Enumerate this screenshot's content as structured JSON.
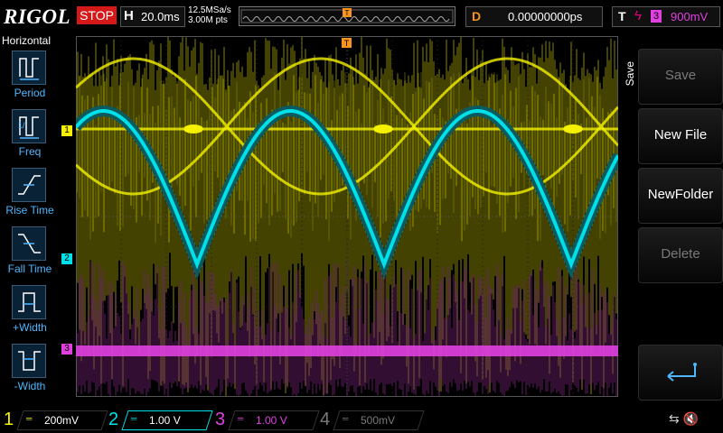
{
  "header": {
    "brand": "RIGOL",
    "run_state": "STOP",
    "timebase_label": "H",
    "timebase_value": "20.0ms",
    "sample_rate": "12.5MSa/s",
    "memory_depth": "3.00M pts",
    "trigger_pos_marker": "T",
    "delay_label": "D",
    "delay_value": "0.00000000ps",
    "trigger_label": "T",
    "trigger_edge": "ϟ",
    "trigger_source": "3",
    "trigger_level": "900mV"
  },
  "left_menu": {
    "title": "Horizontal",
    "items": [
      {
        "label": "Period",
        "icon": "period-icon"
      },
      {
        "label": "Freq",
        "icon": "freq-icon"
      },
      {
        "label": "Rise Time",
        "icon": "rise-time-icon"
      },
      {
        "label": "Fall Time",
        "icon": "fall-time-icon"
      },
      {
        "label": "+Width",
        "icon": "positive-width-icon"
      },
      {
        "label": "-Width",
        "icon": "negative-width-icon"
      }
    ]
  },
  "right_menu": {
    "title": "Save",
    "buttons": [
      {
        "label": "Save",
        "enabled": false
      },
      {
        "label": "New File",
        "enabled": true
      },
      {
        "label": "NewFolder",
        "enabled": true
      },
      {
        "label": "Delete",
        "enabled": false
      },
      {
        "label": "",
        "icon": "return-arrow-icon",
        "enabled": true
      }
    ]
  },
  "markers": {
    "ch1": "1",
    "ch2": "2",
    "ch3": "3",
    "trigger": "T"
  },
  "channels": [
    {
      "number": "1",
      "coupling": "═",
      "scale": "200mV",
      "color": "#f4f000"
    },
    {
      "number": "2",
      "coupling": "═",
      "scale": "1.00 V",
      "color": "#00e0e8"
    },
    {
      "number": "3",
      "coupling": "═",
      "scale": "1.00 V",
      "color": "#e040e0"
    },
    {
      "number": "4",
      "coupling": "═",
      "scale": "500mV",
      "color": "#5a5aff"
    }
  ],
  "colors": {
    "ch1": "#f4f000",
    "ch2": "#00e0e8",
    "ch3": "#e040e0",
    "ch4": "#5a5aff",
    "trigger": "#f7941d",
    "stop": "#d51818"
  },
  "status": {
    "usb": "⇆",
    "sound": "🔇"
  }
}
